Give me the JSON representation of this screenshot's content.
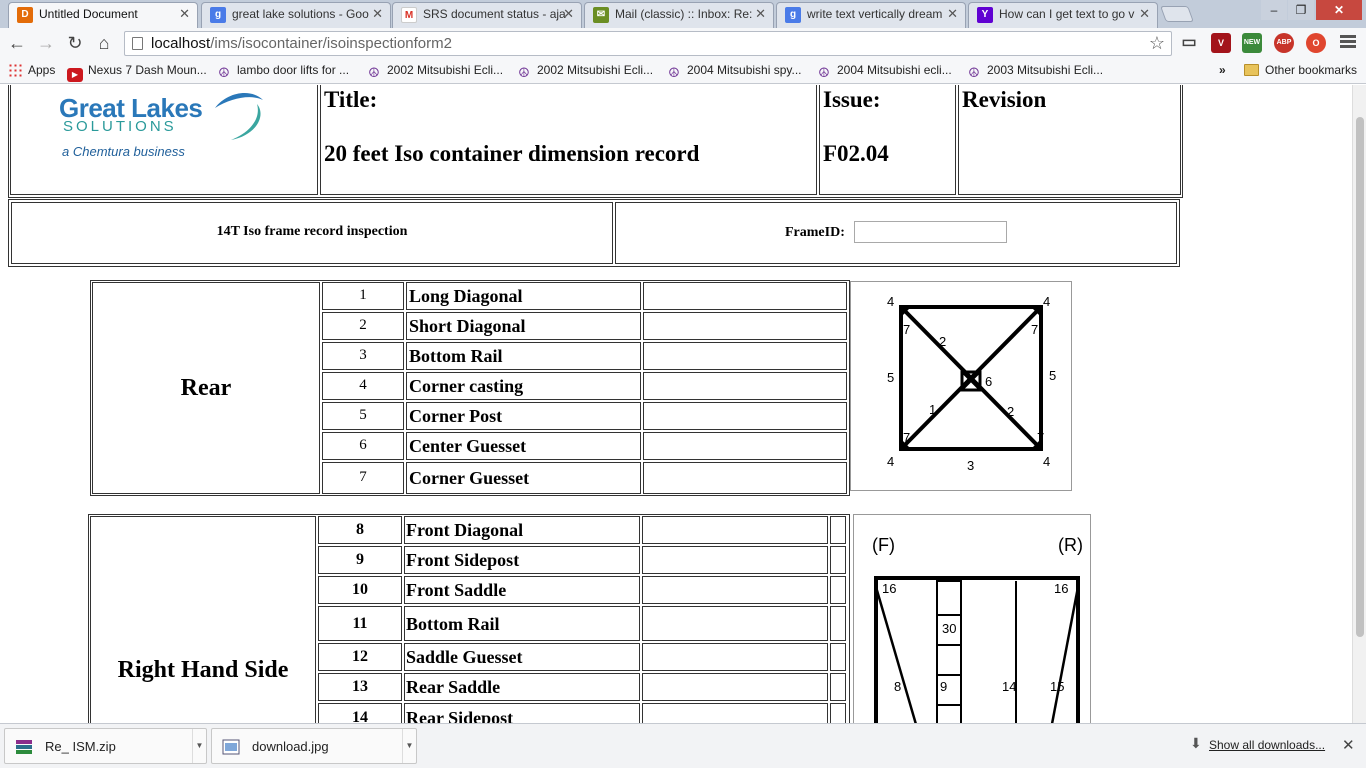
{
  "browser": {
    "tabs": [
      {
        "title": "Untitled Document",
        "icon": "dreamweaver-icon",
        "color": "#e36c09"
      },
      {
        "title": "great lake solutions - Goo",
        "icon": "google-icon",
        "color": "#4a7be8"
      },
      {
        "title": "SRS document status - aja",
        "icon": "gmail-icon",
        "color": "#d93025"
      },
      {
        "title": "Mail (classic) :: Inbox: Re:",
        "icon": "mail-icon",
        "color": "#6b8e23"
      },
      {
        "title": "write text vertically dream",
        "icon": "google-icon",
        "color": "#4a7be8"
      },
      {
        "title": "How can I get text to go v",
        "icon": "yahoo-icon",
        "color": "#6001d2"
      }
    ],
    "url_host": "localhost",
    "url_path": "/ims/isocontainer/isoinspectionform2",
    "extensions": [
      {
        "name": "vivaldi-ext-icon",
        "label": "V",
        "color": "#a3141b"
      },
      {
        "name": "new-ext-icon",
        "label": "NEW",
        "color": "#3b8a3b"
      },
      {
        "name": "adblock-icon",
        "label": "ABP",
        "color": "#c7342a"
      },
      {
        "name": "opera-ext-icon",
        "label": "O",
        "color": "#e0462f"
      }
    ]
  },
  "bookmarks": {
    "apps_label": "Apps",
    "items": [
      "Nexus 7 Dash Moun...",
      "lambo door lifts for ...",
      "2002 Mitsubishi Ecli...",
      "2002 Mitsubishi Ecli...",
      "2004 Mitsubishi spy...",
      "2004 Mitsubishi ecli...",
      "2003 Mitsubishi Ecli..."
    ],
    "overflow": "»",
    "other_label": "Other bookmarks"
  },
  "header": {
    "logo_line1": "Great Lakes",
    "logo_line2": "SOLUTIONS",
    "logo_line3": "a Chemtura business",
    "title_label": "Title:",
    "title_value": "20 feet Iso container dimension record",
    "issue_label": "Issue:",
    "issue_value": "F02.04",
    "revision_label": "Revision"
  },
  "form_bar": {
    "inspection_title": "14T Iso frame record inspection",
    "frameid_label": "FrameID:",
    "frameid_value": ""
  },
  "rear": {
    "label": "Rear",
    "rows": [
      {
        "num": "1",
        "item": "Long Diagonal"
      },
      {
        "num": "2",
        "item": "Short Diagonal"
      },
      {
        "num": "3",
        "item": "Bottom Rail"
      },
      {
        "num": "4",
        "item": "Corner casting"
      },
      {
        "num": "5",
        "item": "Corner Post"
      },
      {
        "num": "6",
        "item": "Center Guesset"
      },
      {
        "num": "7",
        "item": "Corner Guesset"
      }
    ],
    "diagram_labels": [
      "4",
      "4",
      "7",
      "7",
      "2",
      "5",
      "6",
      "5",
      "1",
      "2",
      "7",
      "7",
      "4",
      "3",
      "4"
    ]
  },
  "right_side": {
    "label": "Right Hand Side",
    "rows": [
      {
        "num": "8",
        "item": "Front Diagonal"
      },
      {
        "num": "9",
        "item": "Front Sidepost"
      },
      {
        "num": "10",
        "item": "Front Saddle"
      },
      {
        "num": "11",
        "item": "Bottom Rail"
      },
      {
        "num": "12",
        "item": "Saddle Guesset"
      },
      {
        "num": "13",
        "item": "Rear Saddle"
      },
      {
        "num": "14",
        "item": "Rear Sidepost"
      }
    ],
    "diagram_labels": [
      "(F)",
      "(R)",
      "16",
      "16",
      "30",
      "8",
      "9",
      "14",
      "15"
    ]
  },
  "downloads": {
    "items": [
      {
        "name": "Re_ ISM.zip",
        "icon": "zip-archive-icon"
      },
      {
        "name": "download.jpg",
        "icon": "image-file-icon"
      }
    ],
    "show_all": "Show all downloads..."
  }
}
